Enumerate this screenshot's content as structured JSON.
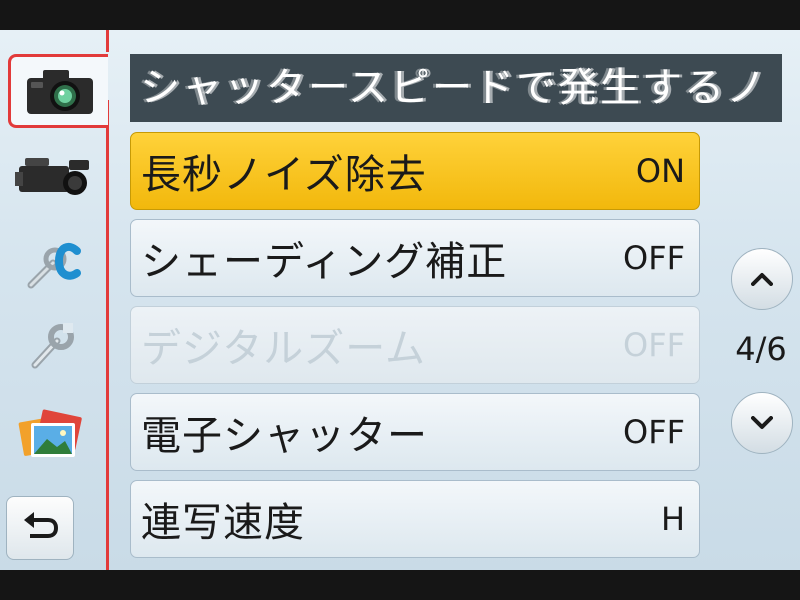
{
  "header": {
    "text": "シャッタースピードで発生するノ"
  },
  "sidebar": {
    "tabs": [
      {
        "name": "camera-icon",
        "active": true
      },
      {
        "name": "video-camera-icon",
        "active": false
      },
      {
        "name": "custom-wrench-icon",
        "active": false
      },
      {
        "name": "setup-wrench-icon",
        "active": false
      },
      {
        "name": "playback-photos-icon",
        "active": false
      }
    ],
    "back_icon": "return-arrow-icon"
  },
  "menu": {
    "items": [
      {
        "label": "長秒ノイズ除去",
        "value": "ON",
        "state": "selected"
      },
      {
        "label": "シェーディング補正",
        "value": "OFF",
        "state": "normal"
      },
      {
        "label": "デジタルズーム",
        "value": "OFF",
        "state": "disabled"
      },
      {
        "label": "電子シャッター",
        "value": "OFF",
        "state": "normal"
      },
      {
        "label": "連写速度",
        "value": "H",
        "state": "normal"
      }
    ]
  },
  "pagination": {
    "indicator": "4/6"
  },
  "colors": {
    "accent_red": "#e23a3a",
    "selected_yellow": "#f5c21b",
    "header_bg": "#3d4a52"
  }
}
